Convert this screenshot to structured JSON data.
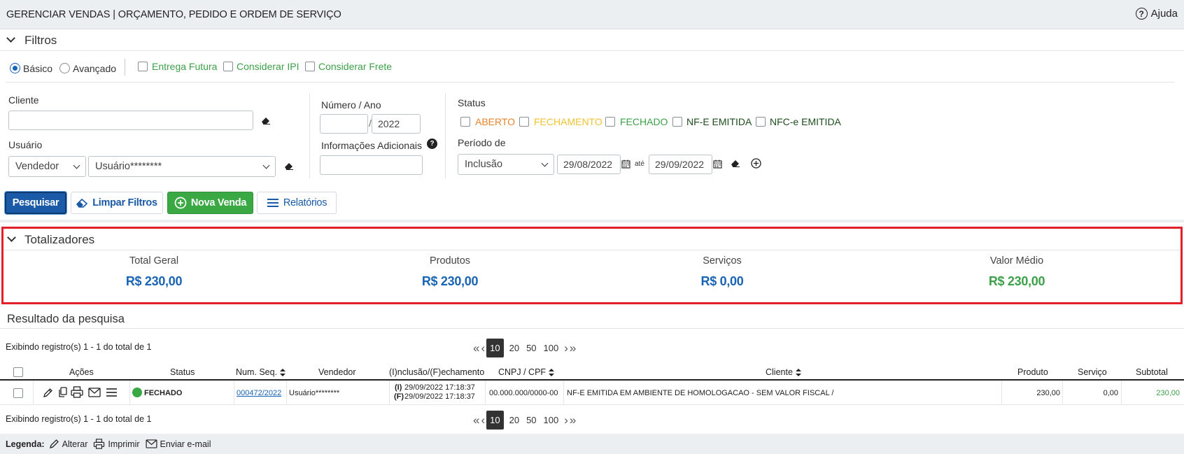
{
  "header": {
    "title": "GERENCIAR VENDAS | ORÇAMENTO, PEDIDO E ORDEM DE SERVIÇO",
    "help_label": "Ajuda"
  },
  "filters": {
    "section_title": "Filtros",
    "mode_basic": "Básico",
    "mode_advanced": "Avançado",
    "checks": [
      "Entrega Futura",
      "Considerar IPI",
      "Considerar Frete"
    ],
    "cliente_label": "Cliente",
    "cliente_value": "",
    "usuario_label": "Usuário",
    "usuario_type": "Vendedor",
    "usuario_value": "Usuário********",
    "numero_label": "Número / Ano",
    "numero_value": "",
    "ano_value": "2022",
    "info_label": "Informações Adicionais",
    "info_value": "",
    "status_label": "Status",
    "status_options": [
      {
        "label": "ABERTO",
        "color": "#e8842a"
      },
      {
        "label": "FECHAMENTO",
        "color": "#f2c233"
      },
      {
        "label": "FECHADO",
        "color": "#3ea04a"
      },
      {
        "label": "NF-E EMITIDA",
        "color": "#1e4d1e"
      },
      {
        "label": "NFC-e EMITIDA",
        "color": "#1e4d1e"
      }
    ],
    "periodo_label": "Período de",
    "periodo_type": "Inclusão",
    "date_from": "29/08/2022",
    "date_sep": "até",
    "date_to": "29/09/2022"
  },
  "actions": {
    "search": "Pesquisar",
    "clear": "Limpar Filtros",
    "new_sale": "Nova Venda",
    "reports": "Relatórios"
  },
  "totals": {
    "section_title": "Totalizadores",
    "items": [
      {
        "label": "Total Geral",
        "value": "R$ 230,00",
        "color": "#1a64b5"
      },
      {
        "label": "Produtos",
        "value": "R$ 230,00",
        "color": "#1a64b5"
      },
      {
        "label": "Serviços",
        "value": "R$ 0,00",
        "color": "#1a64b5"
      },
      {
        "label": "Valor Médio",
        "value": "R$ 230,00",
        "color": "#3ea04a"
      }
    ]
  },
  "results": {
    "section_title": "Resultado da pesquisa",
    "records_info": "Exibindo registro(s) 1 - 1 do total de 1",
    "page_sizes": [
      "10",
      "20",
      "50",
      "100"
    ],
    "columns": [
      "Ações",
      "Status",
      "Num. Seq.",
      "Vendedor",
      "(I)nclusão/(F)echamento",
      "CNPJ / CPF",
      "Cliente",
      "Produto",
      "Serviço",
      "Subtotal"
    ],
    "rows": [
      {
        "status": "FECHADO",
        "num_seq": "000472/2022",
        "vendedor": "Usuário********",
        "inclusao_tag": "(I)",
        "inclusao": "29/09/2022 17:18:37",
        "fechamento_tag": "(F)",
        "fechamento": "29/09/2022 17:18:37",
        "cnpj": "00.000.000/0000-00",
        "cliente": "NF-E EMITIDA EM AMBIENTE DE HOMOLOGACAO - SEM VALOR FISCAL /",
        "produto": "230,00",
        "servico": "0,00",
        "subtotal": "230,00"
      }
    ]
  },
  "legend": {
    "title": "Legenda:",
    "alter": "Alterar",
    "print": "Imprimir",
    "email": "Enviar e-mail"
  }
}
